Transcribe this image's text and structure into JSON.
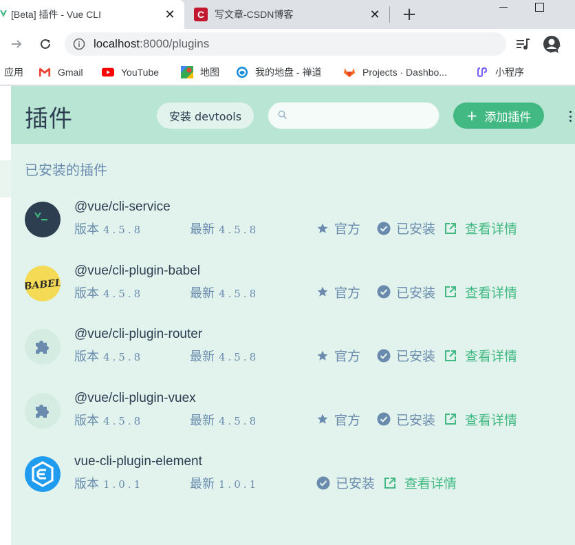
{
  "browser": {
    "tabs": [
      {
        "title": "[Beta] 插件 - Vue CLI",
        "active": true
      },
      {
        "title": "写文章-CSDN博客",
        "active": false
      }
    ],
    "url_host": "localhost",
    "url_rest": ":8000/plugins"
  },
  "bookmarks": [
    {
      "label": "应用",
      "icon": "apps-icon"
    },
    {
      "label": "Gmail",
      "icon": "gmail-icon"
    },
    {
      "label": "YouTube",
      "icon": "youtube-icon"
    },
    {
      "label": "地图",
      "icon": "maps-icon"
    },
    {
      "label": "我的地盘 - 禅道",
      "icon": "zentao-icon"
    },
    {
      "label": "Projects · Dashbo...",
      "icon": "gitlab-icon"
    },
    {
      "label": "小程序",
      "icon": "miniprogram-icon"
    }
  ],
  "header": {
    "title": "插件",
    "devtools_label": "安装 devtools",
    "search_placeholder": "",
    "add_label": "添加插件"
  },
  "section_title": "已安装的插件",
  "labels": {
    "version": "版本",
    "latest": "最新",
    "official": "官方",
    "installed": "已安装",
    "details": "查看详情"
  },
  "plugins": [
    {
      "name": "@vue/cli-service",
      "version": "4.5.8",
      "latest": "4.5.8",
      "official": true,
      "installed": true,
      "logo": "vue-cli-terminal-logo"
    },
    {
      "name": "@vue/cli-plugin-babel",
      "version": "4.5.8",
      "latest": "4.5.8",
      "official": true,
      "installed": true,
      "logo": "babel-logo"
    },
    {
      "name": "@vue/cli-plugin-router",
      "version": "4.5.8",
      "latest": "4.5.8",
      "official": true,
      "installed": true,
      "logo": "puzzle-logo"
    },
    {
      "name": "@vue/cli-plugin-vuex",
      "version": "4.5.8",
      "latest": "4.5.8",
      "official": true,
      "installed": true,
      "logo": "puzzle-logo"
    },
    {
      "name": "vue-cli-plugin-element",
      "version": "1.0.1",
      "latest": "1.0.1",
      "official": false,
      "installed": true,
      "logo": "element-logo"
    }
  ],
  "colors": {
    "accent": "#42b983",
    "header_bg": "#b9e5d4",
    "content_bg": "#e1f3ec",
    "muted_text": "#6a8bad",
    "title_text": "#2c3e50"
  }
}
